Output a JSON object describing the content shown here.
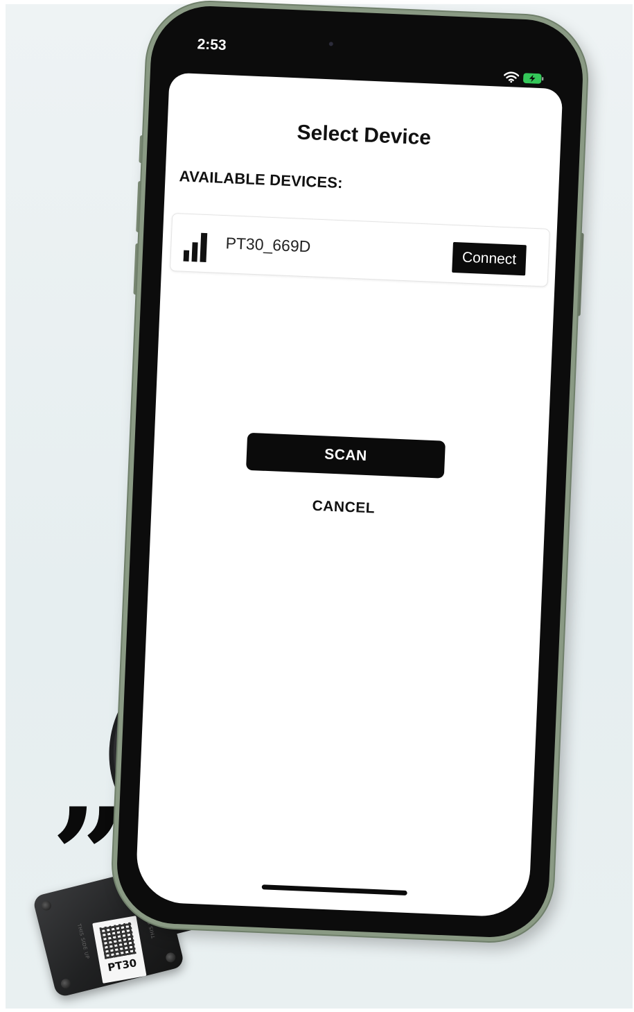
{
  "status_bar": {
    "time": "2:53",
    "wifi_icon": "wifi-icon",
    "battery_icon": "battery-charging-icon",
    "battery_color": "#34c759"
  },
  "screen": {
    "title": "Select Device",
    "section_label": "AVAILABLE DEVICES:",
    "devices": [
      {
        "name": "PT30_669D",
        "signal_icon": "signal-strength-icon",
        "connect_label": "Connect"
      }
    ],
    "scan_label": "SCAN",
    "cancel_label": "CANCEL"
  },
  "hardware": {
    "device_label": "PT30",
    "side_text": "THIS SIDE UP",
    "qr_icon": "qr-code-icon"
  },
  "decoration": {
    "quote_mark": "”"
  }
}
